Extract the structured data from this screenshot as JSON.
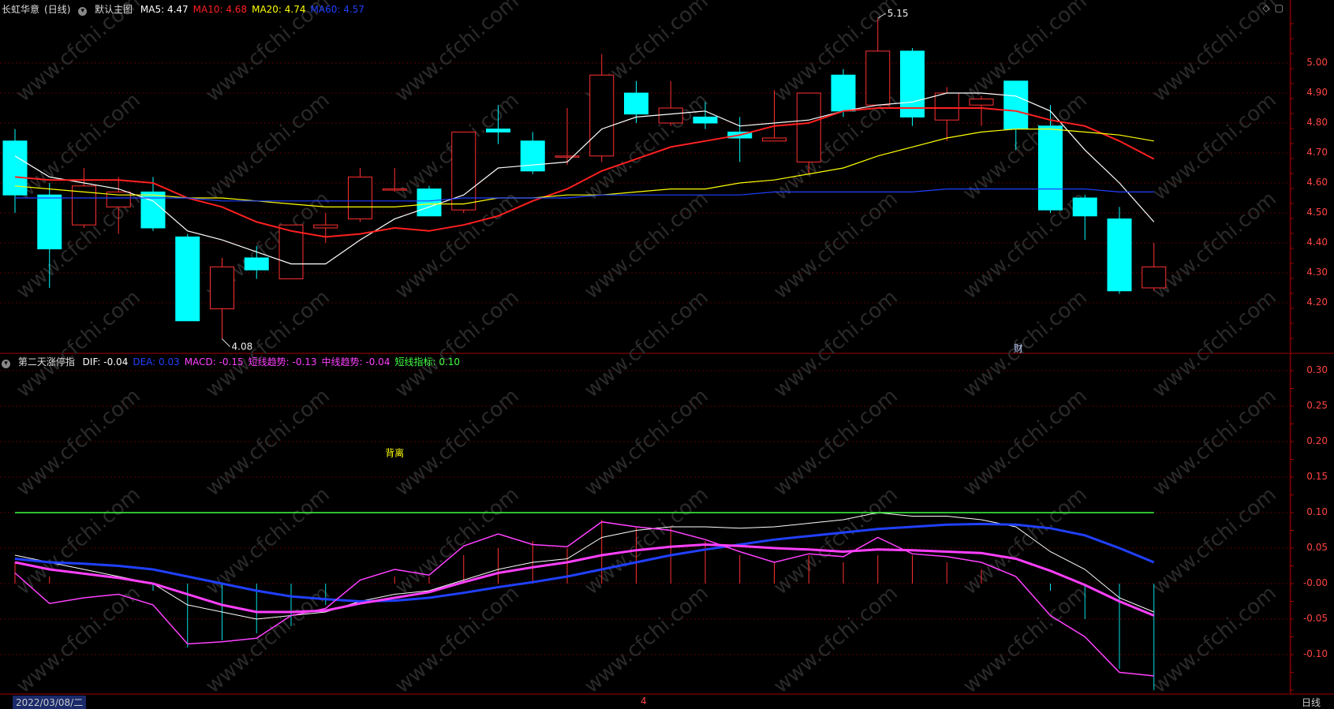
{
  "header_main": {
    "stock": "长虹华意",
    "period": "(日线)",
    "collapse_icon": "chevron-down-icon",
    "preset": "默认主图",
    "ma": [
      {
        "label": "MA5: 4.47",
        "color": "#ffffff"
      },
      {
        "label": "MA10: 4.68",
        "color": "#ff2020"
      },
      {
        "label": "MA20: 4.74",
        "color": "#ffff00"
      },
      {
        "label": "MA60: 4.57",
        "color": "#2040ff"
      }
    ],
    "right_icons": [
      "diamond-icon",
      "window-icon"
    ]
  },
  "header_sub": {
    "name": "第二天涨停指",
    "items": [
      {
        "label": "DIF: -0.04",
        "color": "#ffffff"
      },
      {
        "label": "DEA: 0.03",
        "color": "#2040ff"
      },
      {
        "label": "MACD: -0.15",
        "color": "#ff40ff"
      },
      {
        "label": "短线趋势: -0.13",
        "color": "#ff40ff"
      },
      {
        "label": "中线趋势: -0.04",
        "color": "#ff40ff"
      },
      {
        "label": "短线指标: 0.10",
        "color": "#40ff40"
      }
    ]
  },
  "bottom": {
    "date": "2022/03/08/二",
    "marker": "4",
    "period_label": "日线"
  },
  "chart_data": [
    {
      "type": "candlestick",
      "ylim": [
        4.08,
        5.16
      ],
      "yticks": [
        "5.00",
        "4.90",
        "4.80",
        "4.70",
        "4.60",
        "4.50",
        "4.40",
        "4.30",
        "4.20"
      ],
      "candles": [
        {
          "o": 4.74,
          "h": 4.78,
          "l": 4.5,
          "c": 4.56
        },
        {
          "o": 4.56,
          "h": 4.6,
          "l": 4.25,
          "c": 4.38
        },
        {
          "o": 4.46,
          "h": 4.65,
          "l": 4.45,
          "c": 4.59
        },
        {
          "o": 4.52,
          "h": 4.62,
          "l": 4.43,
          "c": 4.57
        },
        {
          "o": 4.57,
          "h": 4.62,
          "l": 4.44,
          "c": 4.45
        },
        {
          "o": 4.42,
          "h": 4.43,
          "l": 4.14,
          "c": 4.14
        },
        {
          "o": 4.18,
          "h": 4.35,
          "l": 4.08,
          "c": 4.32
        },
        {
          "o": 4.35,
          "h": 4.39,
          "l": 4.28,
          "c": 4.31
        },
        {
          "o": 4.28,
          "h": 4.46,
          "l": 4.28,
          "c": 4.46
        },
        {
          "o": 4.45,
          "h": 4.5,
          "l": 4.4,
          "c": 4.46
        },
        {
          "o": 4.48,
          "h": 4.65,
          "l": 4.47,
          "c": 4.62
        },
        {
          "o": 4.58,
          "h": 4.65,
          "l": 4.57,
          "c": 4.58
        },
        {
          "o": 4.58,
          "h": 4.59,
          "l": 4.49,
          "c": 4.49
        },
        {
          "o": 4.51,
          "h": 4.77,
          "l": 4.5,
          "c": 4.77
        },
        {
          "o": 4.78,
          "h": 4.86,
          "l": 4.73,
          "c": 4.77
        },
        {
          "o": 4.74,
          "h": 4.77,
          "l": 4.63,
          "c": 4.64
        },
        {
          "o": 4.69,
          "h": 4.85,
          "l": 4.66,
          "c": 4.69
        },
        {
          "o": 4.69,
          "h": 5.03,
          "l": 4.67,
          "c": 4.96
        },
        {
          "o": 4.9,
          "h": 4.94,
          "l": 4.8,
          "c": 4.83
        },
        {
          "o": 4.8,
          "h": 4.94,
          "l": 4.79,
          "c": 4.85
        },
        {
          "o": 4.82,
          "h": 4.87,
          "l": 4.78,
          "c": 4.8
        },
        {
          "o": 4.77,
          "h": 4.82,
          "l": 4.67,
          "c": 4.75
        },
        {
          "o": 4.74,
          "h": 4.91,
          "l": 4.74,
          "c": 4.75
        },
        {
          "o": 4.67,
          "h": 4.9,
          "l": 4.63,
          "c": 4.9
        },
        {
          "o": 4.96,
          "h": 4.98,
          "l": 4.82,
          "c": 4.84
        },
        {
          "o": 4.86,
          "h": 5.15,
          "l": 4.86,
          "c": 5.04
        },
        {
          "o": 5.04,
          "h": 5.05,
          "l": 4.79,
          "c": 4.82
        },
        {
          "o": 4.81,
          "h": 4.92,
          "l": 4.74,
          "c": 4.9
        },
        {
          "o": 4.86,
          "h": 4.89,
          "l": 4.79,
          "c": 4.88
        },
        {
          "o": 4.94,
          "h": 4.94,
          "l": 4.71,
          "c": 4.78
        },
        {
          "o": 4.79,
          "h": 4.86,
          "l": 4.5,
          "c": 4.51
        },
        {
          "o": 4.55,
          "h": 4.56,
          "l": 4.41,
          "c": 4.49
        },
        {
          "o": 4.48,
          "h": 4.52,
          "l": 4.23,
          "c": 4.24
        },
        {
          "o": 4.25,
          "h": 4.4,
          "l": 4.24,
          "c": 4.32
        }
      ],
      "series": [
        {
          "name": "MA5",
          "color": "#ffffff",
          "values": [
            4.69,
            4.62,
            4.6,
            4.58,
            4.54,
            4.44,
            4.41,
            4.37,
            4.33,
            4.33,
            4.41,
            4.48,
            4.52,
            4.56,
            4.65,
            4.66,
            4.67,
            4.78,
            4.82,
            4.83,
            4.84,
            4.79,
            4.8,
            4.81,
            4.84,
            4.86,
            4.87,
            4.9,
            4.9,
            4.89,
            4.84,
            4.71,
            4.6,
            4.47
          ]
        },
        {
          "name": "MA10",
          "color": "#ff2020",
          "values": [
            4.62,
            4.61,
            4.61,
            4.61,
            4.6,
            4.55,
            4.52,
            4.47,
            4.44,
            4.42,
            4.43,
            4.45,
            4.44,
            4.46,
            4.49,
            4.54,
            4.58,
            4.64,
            4.68,
            4.72,
            4.74,
            4.76,
            4.79,
            4.8,
            4.84,
            4.85,
            4.85,
            4.85,
            4.85,
            4.84,
            4.81,
            4.79,
            4.74,
            4.68
          ]
        },
        {
          "name": "MA20",
          "color": "#ffff00",
          "values": [
            4.59,
            4.58,
            4.57,
            4.56,
            4.56,
            4.55,
            4.55,
            4.54,
            4.53,
            4.52,
            4.52,
            4.52,
            4.53,
            4.53,
            4.55,
            4.55,
            4.56,
            4.56,
            4.57,
            4.58,
            4.58,
            4.6,
            4.61,
            4.63,
            4.65,
            4.69,
            4.72,
            4.75,
            4.77,
            4.78,
            4.78,
            4.77,
            4.76,
            4.74
          ]
        },
        {
          "name": "MA60",
          "color": "#2040ff",
          "values": [
            4.55,
            4.55,
            4.55,
            4.55,
            4.55,
            4.55,
            4.54,
            4.54,
            4.54,
            4.54,
            4.54,
            4.54,
            4.54,
            4.55,
            4.55,
            4.55,
            4.55,
            4.56,
            4.56,
            4.56,
            4.56,
            4.56,
            4.57,
            4.57,
            4.57,
            4.57,
            4.57,
            4.58,
            4.58,
            4.58,
            4.58,
            4.58,
            4.57,
            4.57
          ]
        }
      ],
      "annotations": [
        {
          "text": "5.15",
          "index": 25,
          "value": 5.15
        },
        {
          "text": "4.08",
          "index": 6,
          "value": 4.08
        },
        {
          "text": "财",
          "index": 29,
          "value": 4.08
        }
      ]
    },
    {
      "type": "line",
      "ylim": [
        -0.15,
        0.33
      ],
      "yticks": [
        "0.30",
        "0.25",
        "0.20",
        "0.15",
        "0.10",
        "0.05",
        "-0.00",
        "-0.05",
        "-0.10"
      ],
      "bars": [
        0.03,
        0.01,
        0.0,
        0.0,
        -0.01,
        -0.09,
        -0.08,
        -0.07,
        -0.06,
        -0.03,
        0.0,
        0.01,
        0.01,
        0.04,
        0.05,
        0.06,
        0.05,
        0.09,
        0.08,
        0.08,
        0.06,
        0.04,
        0.03,
        0.04,
        0.03,
        0.04,
        0.04,
        0.03,
        0.02,
        0.0,
        -0.01,
        -0.05,
        -0.12,
        -0.15
      ],
      "series": [
        {
          "name": "DIF",
          "color": "#ffffff",
          "values": [
            0.04,
            0.03,
            0.02,
            0.01,
            0.0,
            -0.03,
            -0.04,
            -0.05,
            -0.045,
            -0.04,
            -0.025,
            -0.015,
            -0.01,
            0.005,
            0.02,
            0.03,
            0.035,
            0.065,
            0.075,
            0.08,
            0.08,
            0.078,
            0.08,
            0.085,
            0.09,
            0.1,
            0.095,
            0.095,
            0.09,
            0.08,
            0.045,
            0.02,
            -0.02,
            -0.04
          ]
        },
        {
          "name": "DEA",
          "color": "#2040ff",
          "values": [
            0.035,
            0.03,
            0.028,
            0.025,
            0.02,
            0.01,
            0.0,
            -0.01,
            -0.018,
            -0.022,
            -0.025,
            -0.024,
            -0.02,
            -0.013,
            -0.005,
            0.002,
            0.01,
            0.02,
            0.03,
            0.04,
            0.048,
            0.055,
            0.062,
            0.067,
            0.072,
            0.077,
            0.08,
            0.083,
            0.084,
            0.083,
            0.078,
            0.068,
            0.05,
            0.03
          ]
        },
        {
          "name": "短线趋势",
          "color": "#ff40ff",
          "values": [
            0.015,
            -0.028,
            -0.02,
            -0.015,
            -0.03,
            -0.085,
            -0.082,
            -0.077,
            -0.045,
            -0.035,
            0.005,
            0.02,
            0.012,
            0.053,
            0.07,
            0.055,
            0.052,
            0.087,
            0.08,
            0.075,
            0.062,
            0.045,
            0.03,
            0.042,
            0.038,
            0.065,
            0.042,
            0.038,
            0.03,
            0.01,
            -0.045,
            -0.075,
            -0.125,
            -0.13
          ]
        },
        {
          "name": "中线趋势",
          "color": "#ff40ff",
          "values": [
            0.03,
            0.02,
            0.014,
            0.008,
            0.0,
            -0.015,
            -0.03,
            -0.04,
            -0.04,
            -0.038,
            -0.028,
            -0.02,
            -0.012,
            0.002,
            0.015,
            0.023,
            0.03,
            0.04,
            0.047,
            0.052,
            0.055,
            0.053,
            0.05,
            0.048,
            0.045,
            0.048,
            0.047,
            0.045,
            0.043,
            0.035,
            0.018,
            -0.002,
            -0.025,
            -0.045
          ]
        },
        {
          "name": "短线指标",
          "color": "#40ff40",
          "values": [
            0.1,
            0.1,
            0.1,
            0.1,
            0.1,
            0.1,
            0.1,
            0.1,
            0.1,
            0.1,
            0.1,
            0.1,
            0.1,
            0.1,
            0.1,
            0.1,
            0.1,
            0.1,
            0.1,
            0.1,
            0.1,
            0.1,
            0.1,
            0.1,
            0.1,
            0.1,
            0.1,
            0.1,
            0.1,
            0.1,
            0.1,
            0.1,
            0.1,
            0.1
          ]
        }
      ],
      "annotations": [
        {
          "text": "背离",
          "index": 11,
          "value": 0.185
        }
      ]
    }
  ]
}
